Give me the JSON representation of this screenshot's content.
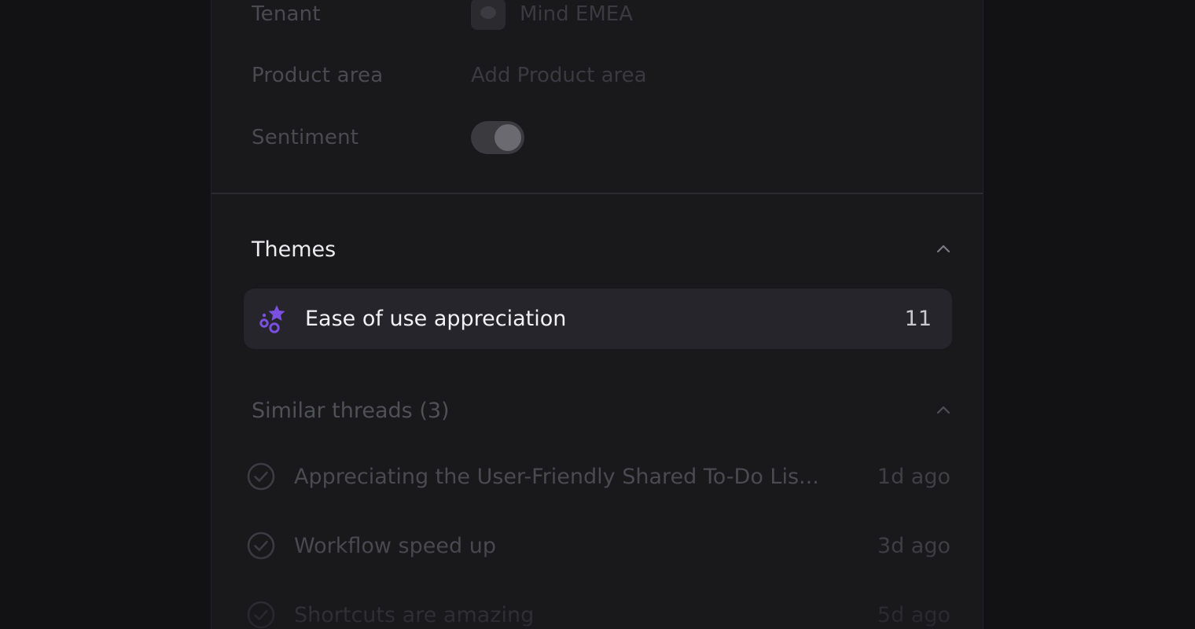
{
  "properties": {
    "tenant_label": "Tenant",
    "tenant_value": "Mind EMEA",
    "product_area_label": "Product area",
    "product_area_placeholder": "Add Product area",
    "sentiment_label": "Sentiment",
    "sentiment_enabled": true
  },
  "themes": {
    "title": "Themes",
    "items": [
      {
        "label": "Ease of use appreciation",
        "count": "11",
        "icon": "stars-icon",
        "accent": "#7b4fe0"
      }
    ]
  },
  "similar_threads": {
    "title": "Similar threads (3)",
    "items": [
      {
        "title": "Appreciating the User-Friendly Shared To-Do Lis...",
        "time": "1d ago"
      },
      {
        "title": "Workflow speed up",
        "time": "3d ago"
      },
      {
        "title": "Shortcuts are amazing",
        "time": "5d ago"
      }
    ]
  }
}
